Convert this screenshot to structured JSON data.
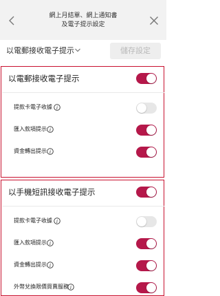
{
  "header": {
    "title_line1": "網上月結單、網上通知書",
    "title_line2": "及電子提示設定"
  },
  "subbar": {
    "dropdown_label": "以電郵接收電子提示",
    "save_label": "儲存設定"
  },
  "colors": {
    "accent": "#b5184a",
    "highlight_border": "#c8102e",
    "toggle_off": "#e7e7e7"
  },
  "email_section": {
    "title": "以電郵接收電子提示",
    "master_on": true,
    "items": [
      {
        "label": "提款卡電子收據",
        "info": true,
        "on": false
      },
      {
        "label": "匯入款項提示",
        "info": true,
        "on": true
      },
      {
        "label": "資金轉出提示",
        "info": true,
        "on": true
      }
    ]
  },
  "sms_section": {
    "title": "以手機短訊接收電子提示",
    "master_on": true,
    "items": [
      {
        "label": "提款卡電子收據",
        "info": true,
        "on": false
      },
      {
        "label": "匯入款項提示",
        "info": true,
        "on": true
      },
      {
        "label": "資金轉出提示",
        "info": true,
        "on": true
      },
      {
        "label": "外幣兌換限價買賣服務",
        "info": true,
        "on": true
      }
    ]
  }
}
